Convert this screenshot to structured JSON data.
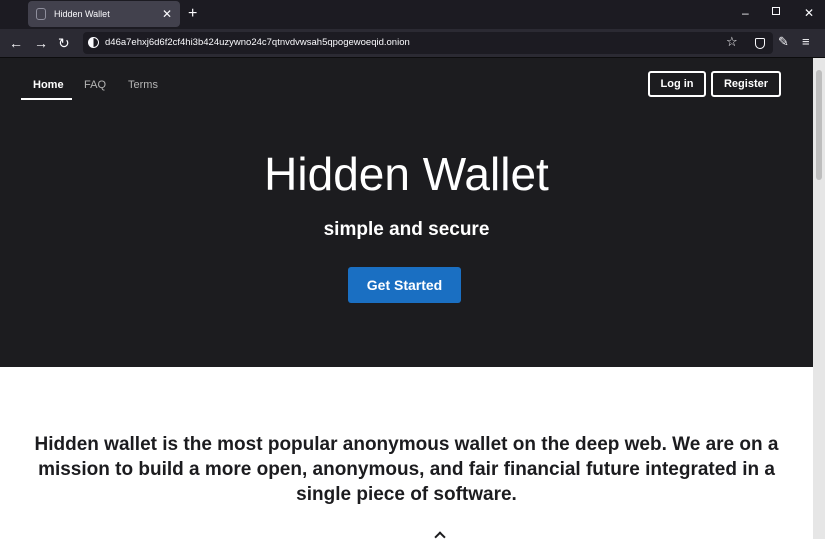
{
  "browser": {
    "tab": {
      "title": "Hidden Wallet",
      "close_symbol": "✕",
      "favicon_icon": "page-icon"
    },
    "new_tab_symbol": "+",
    "window_controls": {
      "minimize": "–",
      "maximize": "",
      "close": "✕"
    },
    "nav": {
      "back": "←",
      "forward": "→",
      "reload": "↻"
    },
    "url": "d46a7ehxj6d6f2cf4hi3b424uzywno24c7qtnvdvwsah5qpogewoeqid.onion",
    "toolbar": {
      "bookmark": "☆",
      "shield_icon": "shield-icon",
      "brush": "✎",
      "menu": "≡"
    }
  },
  "site": {
    "nav": {
      "home": "Home",
      "faq": "FAQ",
      "terms": "Terms"
    },
    "login": "Log in",
    "register": "Register",
    "hero": {
      "title": "Hidden Wallet",
      "subtitle": "simple and secure",
      "cta": "Get Started"
    },
    "mission": "Hidden wallet is the most popular anonymous wallet on the deep web. We are on a mission to build a more open, anonymous, and fair financial future integrated in a single piece of software."
  },
  "colors": {
    "hero_bg": "#1c1c1f",
    "cta_bg": "#1a6fc2",
    "content_bg": "#ffffff"
  }
}
